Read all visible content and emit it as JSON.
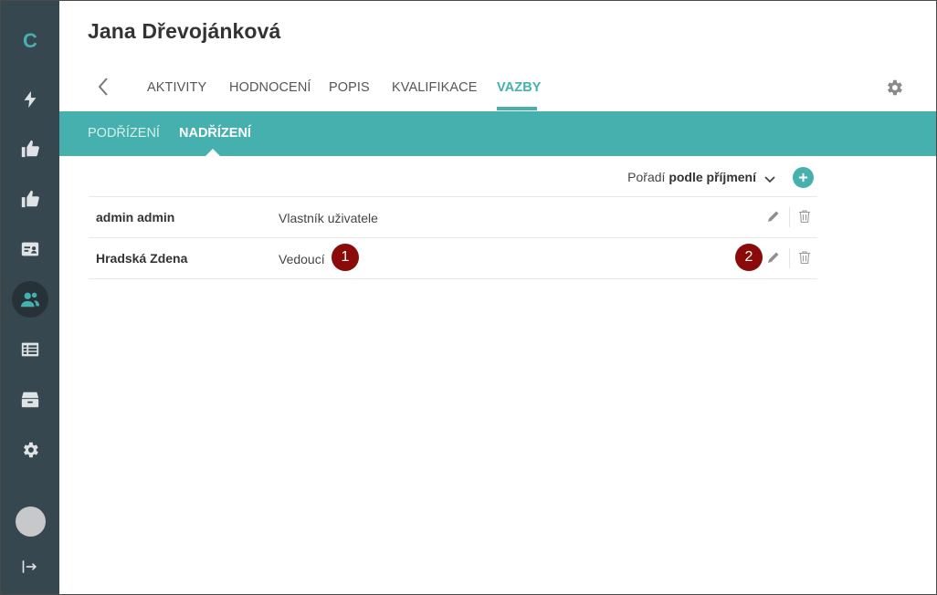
{
  "sidebar": {
    "logo": "C",
    "items": [
      {
        "icon": "lightning-icon"
      },
      {
        "icon": "thumbs-up-icon"
      },
      {
        "icon": "thumbs-up-icon"
      },
      {
        "icon": "id-card-icon"
      },
      {
        "icon": "people-icon",
        "active": true
      },
      {
        "icon": "table-icon"
      },
      {
        "icon": "archive-icon"
      },
      {
        "icon": "gear-icon"
      }
    ]
  },
  "header": {
    "title": "Jana Dřevojánková"
  },
  "tabs": [
    {
      "label": "AKTIVITY"
    },
    {
      "label": "HODNOCENÍ"
    },
    {
      "label": "POPIS"
    },
    {
      "label": "KVALIFIKACE"
    },
    {
      "label": "VAZBY",
      "active": true
    }
  ],
  "subtabs": [
    {
      "label": "PODŘÍZENÍ"
    },
    {
      "label": "NADŘÍZENÍ",
      "active": true
    }
  ],
  "sort": {
    "prefix": "Pořadí",
    "value": "podle příjmení"
  },
  "rows": [
    {
      "name": "admin admin",
      "role": "Vlastník uživatele"
    },
    {
      "name": "Hradská Zdena",
      "role": "Vedoucí"
    }
  ],
  "annotations": [
    "1",
    "2"
  ],
  "colors": {
    "accent": "#45b0ad",
    "sidebar": "#37474f",
    "marker": "#8b0a0a"
  }
}
